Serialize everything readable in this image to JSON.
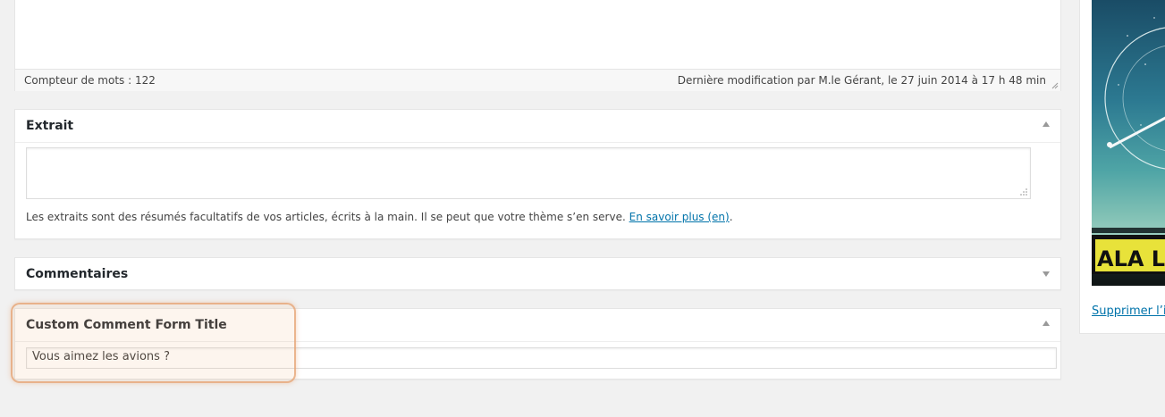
{
  "editor": {
    "word_count": "Compteur de mots : 122",
    "last_modified": "Dernière modification par M.le Gérant, le 27 juin 2014 à 17 h 48 min"
  },
  "excerpt_box": {
    "title": "Extrait",
    "textarea_value": "",
    "help_text": "Les extraits sont des résumés facultatifs de vos articles, écrits à la main. Il se peut que votre thème s’en serve. ",
    "help_link": "En savoir plus (en)",
    "help_suffix": "."
  },
  "comments_box": {
    "title": "Commentaires"
  },
  "custom_comment_box": {
    "title": "Custom Comment Form Title",
    "input_value": "Vous aimez les avions ?"
  },
  "side_panel": {
    "poster_text": "ALA LIT",
    "remove_link": "Supprimer l’im"
  },
  "colors": {
    "page_bg": "#f1f1f1",
    "link": "#0073aa",
    "highlight": "#e6a06e",
    "poster_band": "#e8e23a"
  }
}
